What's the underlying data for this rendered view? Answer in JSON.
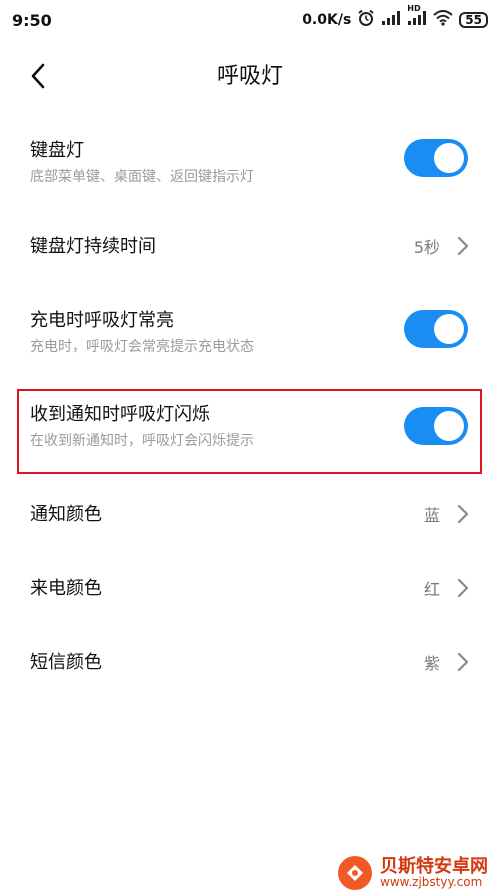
{
  "status_bar": {
    "time": "9:50",
    "net_speed": "0.0K/s",
    "hd_label": "HD",
    "battery": "55",
    "icons": [
      "alarm-icon",
      "signal-icon",
      "signal-hd-icon",
      "wifi-icon",
      "battery-icon"
    ]
  },
  "app_bar": {
    "title": "呼吸灯",
    "back_icon": "back-arrow-icon"
  },
  "settings": [
    {
      "title": "键盘灯",
      "desc": "底部菜单键、桌面键、返回键指示灯",
      "type": "toggle",
      "on": true
    },
    {
      "title": "键盘灯持续时间",
      "type": "nav",
      "value": "5秒"
    },
    {
      "title": "充电时呼吸灯常亮",
      "desc": "充电时，呼吸灯会常亮提示充电状态",
      "type": "toggle",
      "on": true
    },
    {
      "title": "收到通知时呼吸灯闪烁",
      "desc": "在收到新通知时，呼吸灯会闪烁提示",
      "type": "toggle",
      "on": true,
      "highlighted": true
    },
    {
      "title": "通知颜色",
      "type": "nav",
      "value": "蓝"
    },
    {
      "title": "来电颜色",
      "type": "nav",
      "value": "红"
    },
    {
      "title": "短信颜色",
      "type": "nav",
      "value": "紫"
    }
  ],
  "colors": {
    "toggle_on": "#1a8df3",
    "highlight": "#e0161e",
    "desc_text": "#9b9b9b",
    "value_text": "#7a7a7a"
  },
  "watermark": {
    "name": "贝斯特安卓网",
    "url": "www.zjbstyy.com"
  }
}
